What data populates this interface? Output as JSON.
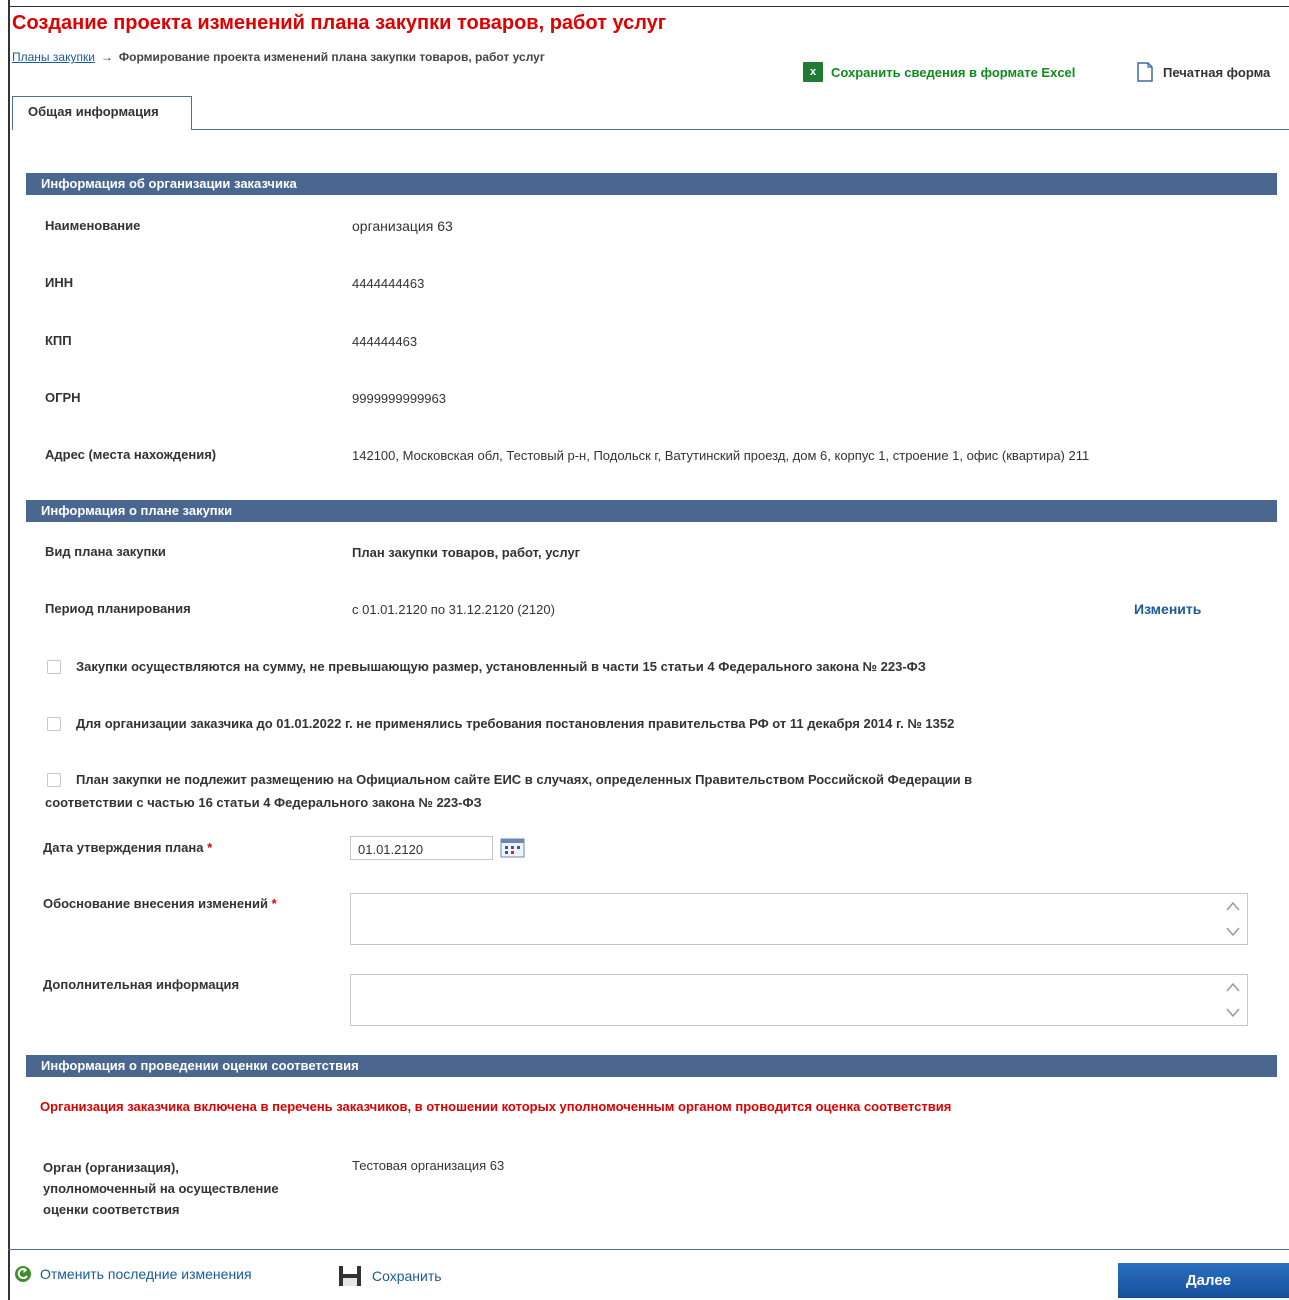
{
  "header": {
    "title": "Создание проекта изменений плана закупки товаров, работ услуг",
    "breadcrumb_link": "Планы закупки",
    "breadcrumb_arrow": "→",
    "breadcrumb_current": "Формирование проекта изменений плана закупки товаров, работ услуг",
    "excel_label": "Сохранить сведения в формате Excel",
    "print_label": "Печатная форма"
  },
  "tabs": [
    {
      "label": "Общая информация",
      "active": true
    }
  ],
  "customer": {
    "section_title": "Информация об организации заказчика",
    "fields": [
      {
        "label": "Наименование",
        "value": "организация 63"
      },
      {
        "label": "ИНН",
        "value": "4444444463"
      },
      {
        "label": "КПП",
        "value": "444444463"
      },
      {
        "label": "ОГРН",
        "value": "9999999999963"
      },
      {
        "label": "Адрес (места нахождения)",
        "value": "142100, Московская обл, Тестовый р-н, Подольск г, Ватутинский проезд, дом 6, корпус 1, строение 1, офис (квартира) 211"
      }
    ]
  },
  "plan": {
    "section_title": "Информация о плане закупки",
    "type_label": "Вид плана закупки",
    "type_value": "План закупки товаров, работ, услуг",
    "period_label": "Период планирования",
    "period_value": "с 01.01.2120 по 31.12.2120 (2120)",
    "change_link": "Изменить",
    "checkboxes": [
      {
        "label": "Закупки осуществляются на сумму, не превышающую размер, установленный в части 15 статьи 4 Федерального закона № 223-ФЗ",
        "checked": false
      },
      {
        "label": "Для организации заказчика до 01.01.2022 г. не применялись требования постановления правительства РФ от 11 декабря 2014 г. № 1352",
        "checked": false
      },
      {
        "label_line1": "План закупки не подлежит размещению на Официальном сайте ЕИС в случаях, определенных Правительством Российской Федерации в",
        "label_line2": "соответствии с частью 16 статьи 4 Федерального закона № 223-ФЗ",
        "checked": false
      }
    ],
    "approval_date_label": "Дата утверждения плана",
    "approval_date_value": "01.01.2120",
    "reason_label": "Обоснование внесения изменений",
    "reason_value": "",
    "extra_label": "Дополнительная информация",
    "extra_value": "",
    "required_mark": "*"
  },
  "assessment": {
    "section_title": "Информация о проведении оценки соответствия",
    "warning": "Организация заказчика включена в перечень заказчиков, в отношении которых уполномоченным органом проводится оценка соответствия",
    "org_label_line1": "Орган (организация),",
    "org_label_line2": "уполномоченный на осуществление",
    "org_label_line3": "оценки соответствия",
    "org_value": "Тестовая организация 63"
  },
  "footer": {
    "undo_label": "Отменить последние изменения",
    "save_label": "Сохранить",
    "next_label": "Далее"
  },
  "colors": {
    "title": "#e00000",
    "section_bar": "#4a6790",
    "link": "#1a5a96",
    "excel": "#118a1d",
    "button": "#1f5fae"
  },
  "icons": [
    "excel-icon",
    "document-icon",
    "calendar-icon",
    "undo-icon",
    "save-disk-icon"
  ]
}
